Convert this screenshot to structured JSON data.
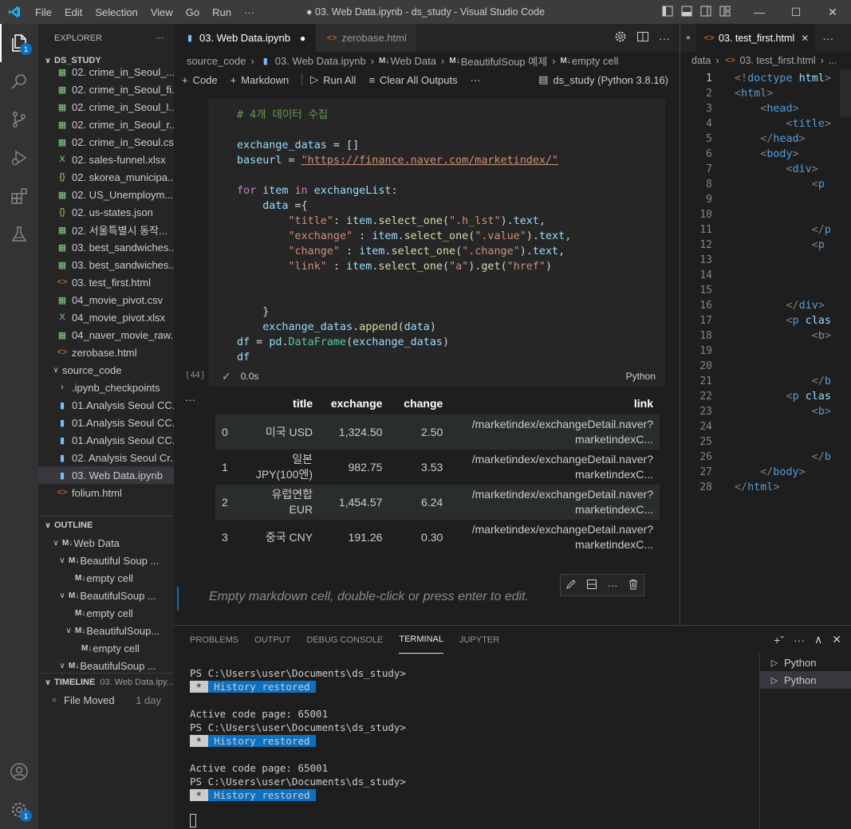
{
  "window": {
    "title": "● 03. Web Data.ipynb - ds_study - Visual Studio Code",
    "menu": [
      "File",
      "Edit",
      "Selection",
      "View",
      "Go",
      "Run",
      "···"
    ]
  },
  "activity": {
    "explorer_badge": "1",
    "settings_badge": "1"
  },
  "sidebar": {
    "header": "EXPLORER",
    "more": "···",
    "folder": "DS_STUDY",
    "files": [
      {
        "name": "02. crime_in_Seoul_...",
        "icon": "csv"
      },
      {
        "name": "02. crime_in_Seoul_fi...",
        "icon": "csv"
      },
      {
        "name": "02. crime_in_Seoul_l...",
        "icon": "csv"
      },
      {
        "name": "02. crime_in_Seoul_r...",
        "icon": "csv"
      },
      {
        "name": "02. crime_in_Seoul.csv",
        "icon": "csv"
      },
      {
        "name": "02. sales-funnel.xlsx",
        "icon": "xlsx"
      },
      {
        "name": "02. skorea_municipa...",
        "icon": "json"
      },
      {
        "name": "02. US_Unemploym...",
        "icon": "csv"
      },
      {
        "name": "02. us-states.json",
        "icon": "json"
      },
      {
        "name": "02. 서울특별시 동작...",
        "icon": "csv"
      },
      {
        "name": "03. best_sandwiches...",
        "icon": "csv"
      },
      {
        "name": "03. best_sandwiches...",
        "icon": "csv"
      },
      {
        "name": "03. test_first.html",
        "icon": "html"
      },
      {
        "name": "04_movie_pivot.csv",
        "icon": "csv"
      },
      {
        "name": "04_movie_pivot.xlsx",
        "icon": "xlsx"
      },
      {
        "name": "04_naver_movie_raw...",
        "icon": "csv"
      },
      {
        "name": "zerobase.html",
        "icon": "html"
      }
    ],
    "subfolder": "source_code",
    "subfiles": [
      {
        "name": ".ipynb_checkpoints",
        "icon": "folder"
      },
      {
        "name": "01.Analysis Seoul CC...",
        "icon": "nb"
      },
      {
        "name": "01.Analysis Seoul CC...",
        "icon": "nb"
      },
      {
        "name": "01.Analysis Seoul CC...",
        "icon": "nb"
      },
      {
        "name": "02. Analysis Seoul Cr...",
        "icon": "nb"
      },
      {
        "name": "03. Web Data.ipynb",
        "icon": "nb"
      },
      {
        "name": "folium.html",
        "icon": "html"
      }
    ],
    "outline": {
      "header": "OUTLINE",
      "items": [
        {
          "label": "Web Data",
          "indent": 0,
          "chev": "v"
        },
        {
          "label": "Beautiful Soup ...",
          "indent": 1,
          "chev": "v"
        },
        {
          "label": "empty cell",
          "indent": 2,
          "chev": ""
        },
        {
          "label": "BeautifulSoup ...",
          "indent": 1,
          "chev": "v"
        },
        {
          "label": "empty cell",
          "indent": 2,
          "chev": ""
        },
        {
          "label": "BeautifulSoup...",
          "indent": 2,
          "chev": "v"
        },
        {
          "label": "empty cell",
          "indent": 3,
          "chev": ""
        },
        {
          "label": "BeautifulSoup ...",
          "indent": 1,
          "chev": "v"
        }
      ]
    },
    "timeline": {
      "header": "TIMELINE",
      "file": "03. Web Data.ipy...",
      "event": "File Moved",
      "when": "1 day"
    }
  },
  "editor1": {
    "tabs": [
      {
        "label": "03. Web Data.ipynb",
        "active": true
      },
      {
        "label": "zerobase.html",
        "active": false
      }
    ],
    "breadcrumbs": [
      "source_code",
      "03. Web Data.ipynb",
      "Web Data",
      "BeautifulSoup 예제",
      "empty cell"
    ],
    "toolbar": {
      "code": "Code",
      "markdown": "Markdown",
      "run_all": "Run All",
      "clear": "Clear All Outputs",
      "more": "···",
      "kernel": "ds_study (Python 3.8.16)"
    },
    "cell": {
      "exec_count": "[44]",
      "time": "0.0s",
      "lang": "Python"
    },
    "markdown_placeholder": "Empty markdown cell, double-click or press enter to edit."
  },
  "dataframe": {
    "columns": [
      "",
      "title",
      "exchange",
      "change",
      "link"
    ],
    "rows": [
      {
        "idx": "0",
        "title": "미국 USD",
        "exchange": "1,324.50",
        "change": "2.50",
        "link": "/marketindex/exchangeDetail.naver?marketindexC..."
      },
      {
        "idx": "1",
        "title": "일본 JPY(100엔)",
        "exchange": "982.75",
        "change": "3.53",
        "link": "/marketindex/exchangeDetail.naver?marketindexC..."
      },
      {
        "idx": "2",
        "title": "유럽연합 EUR",
        "exchange": "1,454.57",
        "change": "6.24",
        "link": "/marketindex/exchangeDetail.naver?marketindexC..."
      },
      {
        "idx": "3",
        "title": "중국 CNY",
        "exchange": "191.26",
        "change": "0.30",
        "link": "/marketindex/exchangeDetail.naver?marketindexC..."
      }
    ]
  },
  "editor2": {
    "tab": "03. test_first.html",
    "breadcrumbs": [
      "data",
      "03. test_first.html",
      "..."
    ]
  },
  "panel": {
    "tabs": [
      "PROBLEMS",
      "OUTPUT",
      "DEBUG CONSOLE",
      "TERMINAL",
      "JUPYTER"
    ],
    "active_tab": "TERMINAL",
    "prompt": "PS C:\\Users\\user\\Documents\\ds_study>",
    "history": "History restored",
    "codepage": "Active code page: 65001",
    "terminals": [
      "Python",
      "Python"
    ]
  }
}
